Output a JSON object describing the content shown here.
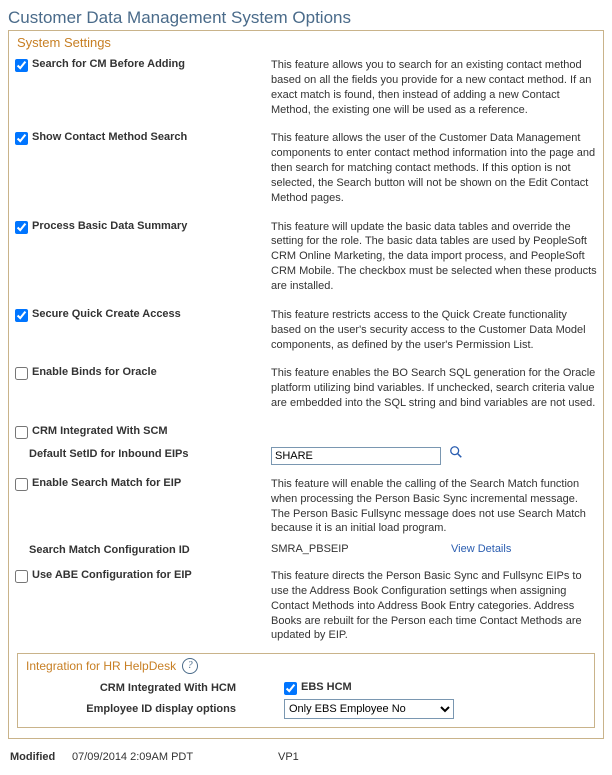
{
  "page_title": "Customer Data Management System Options",
  "group_title": "System Settings",
  "options": {
    "search_cm": {
      "label": "Search for CM Before Adding",
      "checked": true,
      "desc": "This feature allows you to search for an existing contact method based on all the fields you provide for a new contact method. If an exact match is found, then instead of adding a new Contact Method, the existing one will be used as a reference."
    },
    "show_cm_search": {
      "label": "Show Contact Method Search",
      "checked": true,
      "desc": "This feature allows the user of the Customer Data Management components to enter contact method information into the page and then search for matching contact methods. If this option is not selected, the Search button will not be shown on the Edit Contact Method pages."
    },
    "process_basic": {
      "label": "Process Basic Data Summary",
      "checked": true,
      "desc": "This feature will update the basic data tables and override the setting for the role. The basic data tables are used by PeopleSoft CRM Online Marketing, the data import process, and PeopleSoft CRM Mobile. The checkbox must be selected when these products are installed."
    },
    "secure_qc": {
      "label": "Secure Quick Create Access",
      "checked": true,
      "desc": "This feature restricts access to the Quick Create functionality based on the user's security access to the Customer Data Model components, as defined by the user's Permission List."
    },
    "enable_binds": {
      "label": "Enable Binds for Oracle",
      "checked": false,
      "desc": "This feature enables the BO Search SQL generation for the Oracle platform utilizing bind variables. If unchecked, search criteria value are embedded into the SQL string and bind variables are not used."
    },
    "crm_scm": {
      "label": "CRM Integrated With SCM",
      "checked": false
    },
    "default_setid": {
      "label": "Default SetID for Inbound EIPs",
      "value": "SHARE"
    },
    "enable_search_match": {
      "label": "Enable Search Match for EIP",
      "checked": false,
      "desc": "This feature will enable the calling of the Search Match function when processing the Person Basic Sync incremental message. The Person Basic Fullsync message does not use Search Match because it is an initial load program."
    },
    "search_match_config": {
      "label": "Search Match Configuration ID",
      "value": "SMRA_PBSEIP",
      "link": "View Details"
    },
    "use_abe": {
      "label": "Use ABE Configuration for EIP",
      "checked": false,
      "desc": "This feature directs the Person Basic Sync and Fullsync EIPs to use the Address Book Configuration settings when assigning Contact Methods into Address Book Entry categories. Address Books are rebuilt for the Person each time Contact Methods are updated by EIP."
    }
  },
  "hr_helpdesk": {
    "title": "Integration for HR HelpDesk",
    "crm_hcm_label": "CRM Integrated With HCM",
    "ebs_hcm_label": "EBS HCM",
    "ebs_hcm_checked": true,
    "emp_id_label": "Employee ID display options",
    "emp_id_value": "Only EBS Employee No"
  },
  "modified": {
    "label": "Modified",
    "datetime": "07/09/2014  2:09AM PDT",
    "user": "VP1"
  }
}
